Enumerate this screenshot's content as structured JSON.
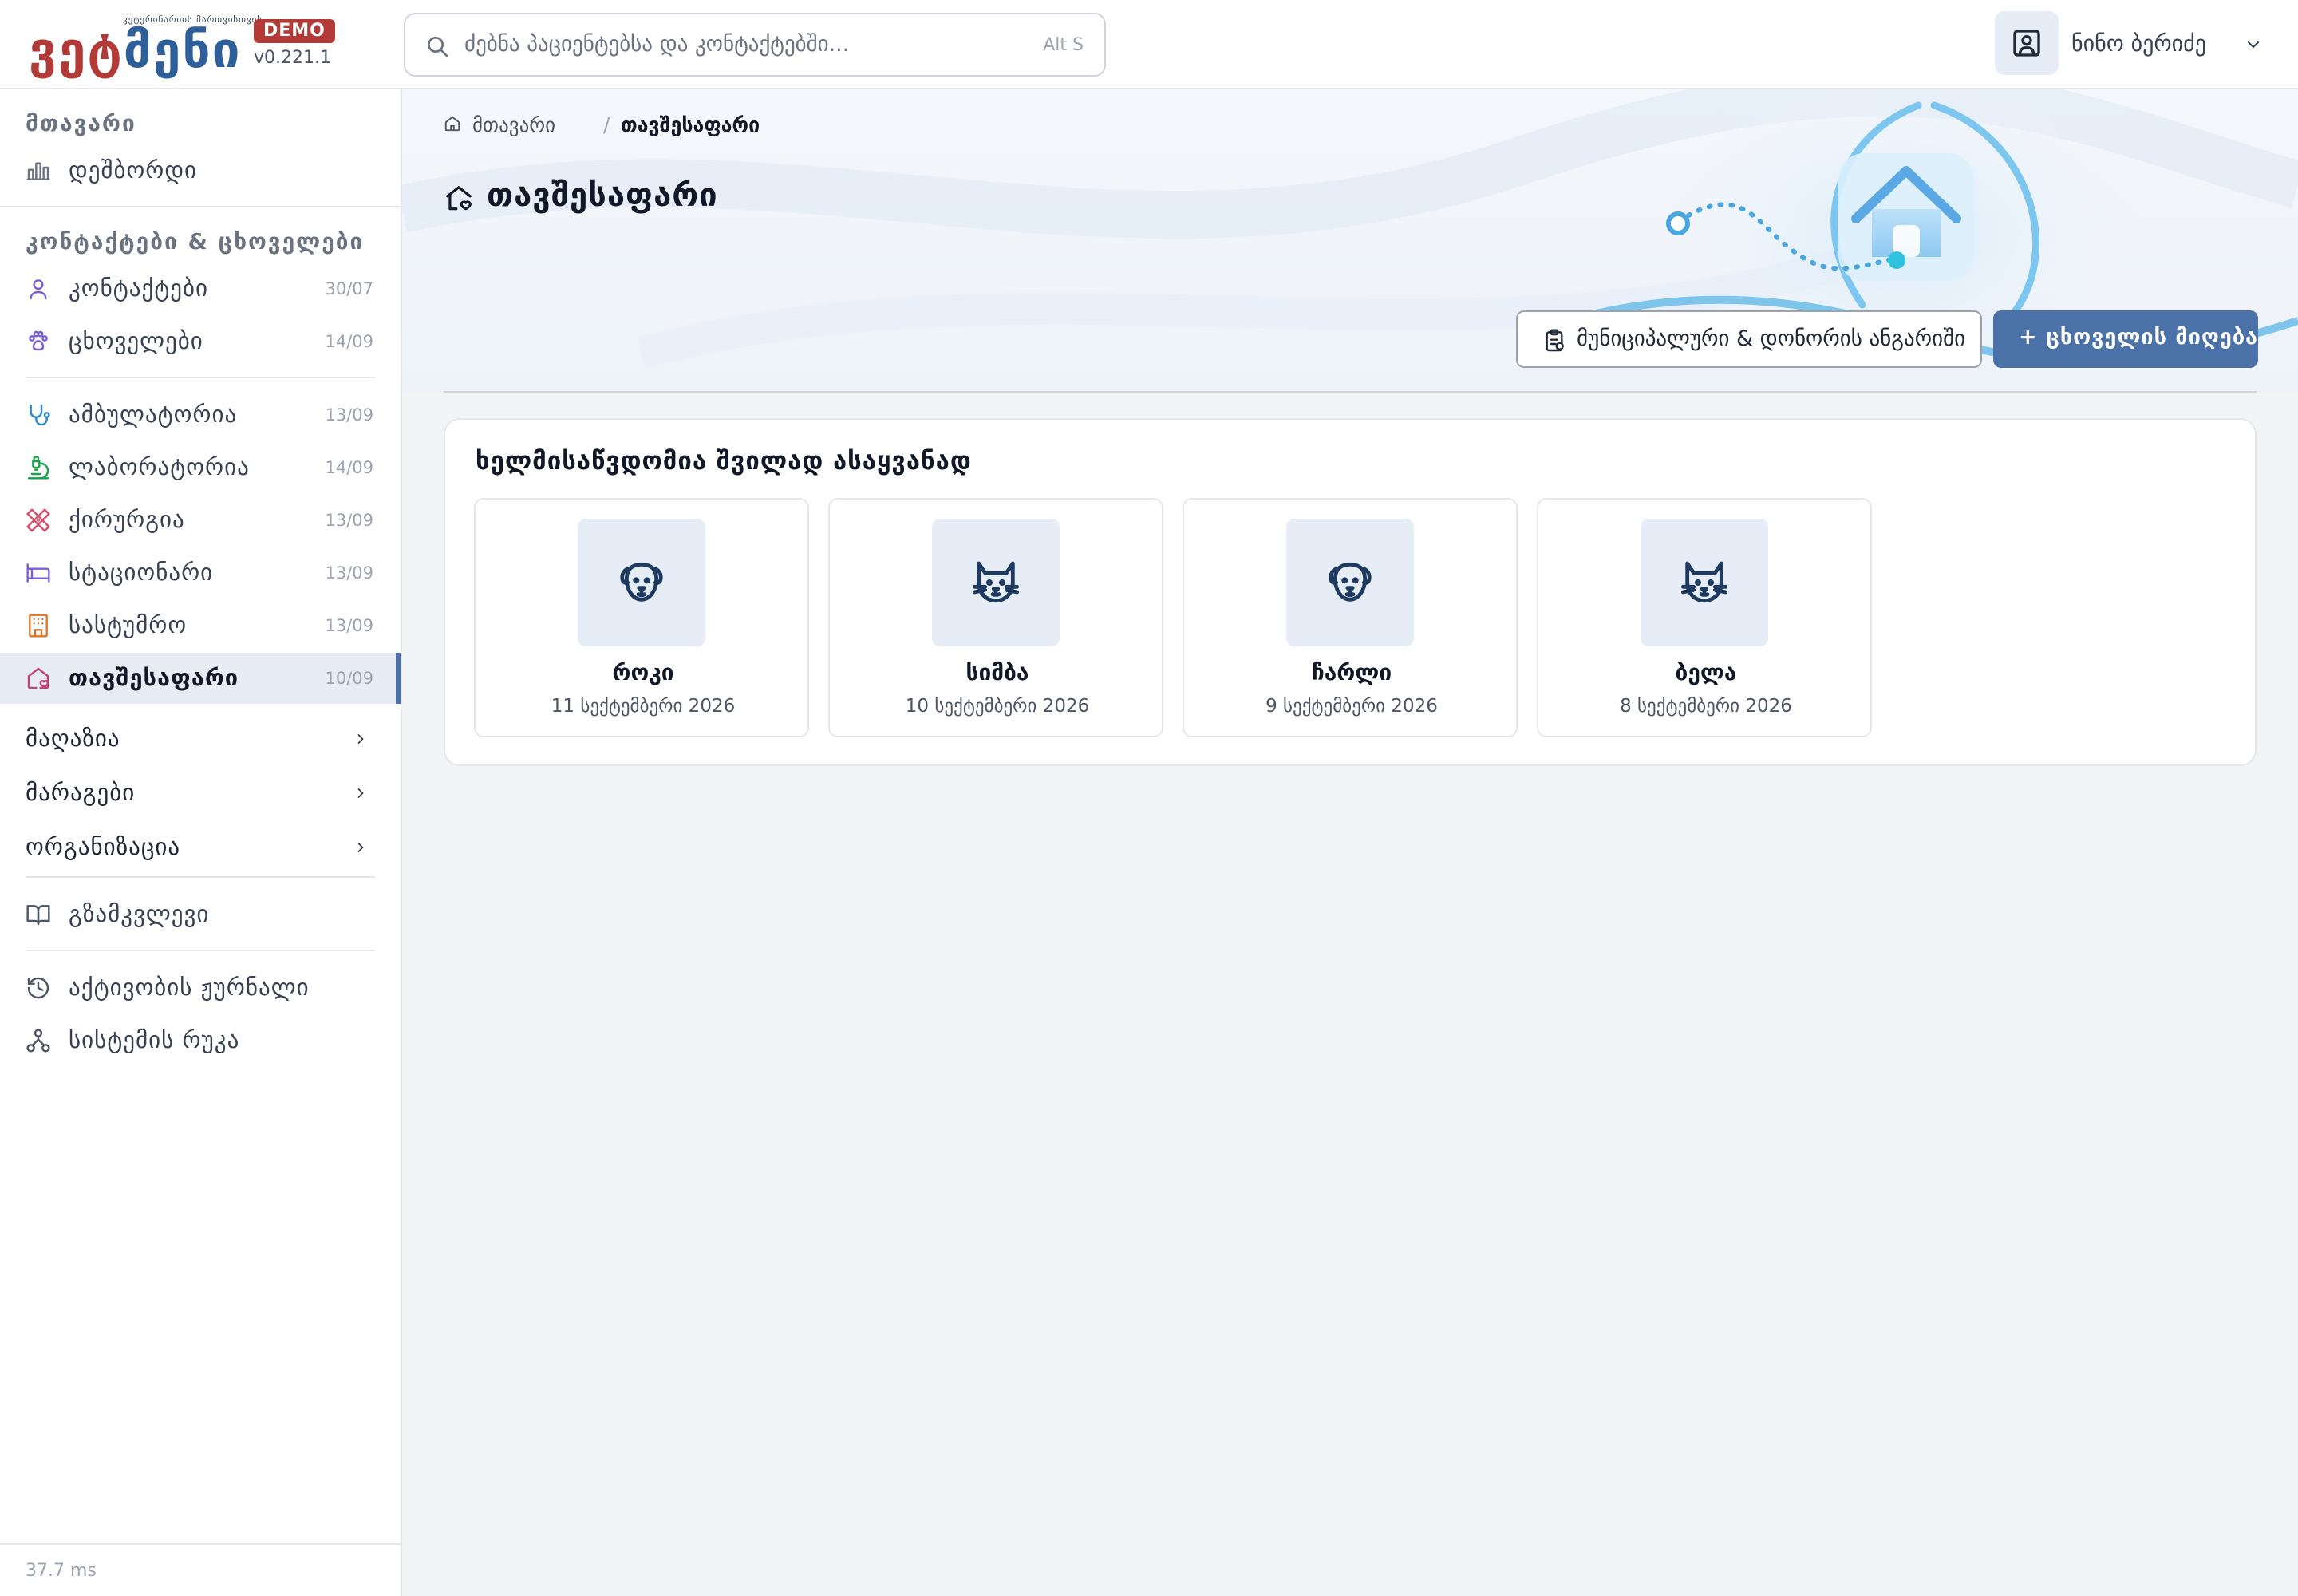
{
  "brand": {
    "logo_text_red": "ვეტ",
    "logo_text_blue": "მენი",
    "tagline": "ვეტერინარიის მართვისთვის",
    "badge": "DEMO",
    "version": "v0.221.1"
  },
  "search": {
    "placeholder": "ძებნა პაციენტებსა და კონტაქტებში...",
    "shortcut": "Alt S",
    "icon": "search-icon"
  },
  "user": {
    "name": "ნინო ბერიძე",
    "icon": "user-square-icon"
  },
  "sidebar": {
    "sections": [
      {
        "title": "მთავარი"
      },
      {
        "title": "კონტაქტები & ცხოველები"
      }
    ],
    "items": [
      {
        "label": "დეშბორდი",
        "count": "",
        "icon": "chart-bar-icon",
        "color": "#6b7280"
      },
      {
        "label": "კონტაქტები",
        "count": "30/07",
        "icon": "person-icon",
        "color": "#7c5cd6"
      },
      {
        "label": "ცხოველები",
        "count": "14/09",
        "icon": "paw-icon",
        "color": "#7c5cd6"
      },
      {
        "label": "ამბულატორია",
        "count": "13/09",
        "icon": "stethoscope-icon",
        "color": "#2a86c8"
      },
      {
        "label": "ლაბორატორია",
        "count": "14/09",
        "icon": "microscope-icon",
        "color": "#16a34a"
      },
      {
        "label": "ქირურგია",
        "count": "13/09",
        "icon": "bandage-icon",
        "color": "#dc4a6a"
      },
      {
        "label": "სტაციონარი",
        "count": "13/09",
        "icon": "bed-icon",
        "color": "#7c5cd6"
      },
      {
        "label": "სასტუმრო",
        "count": "13/09",
        "icon": "building-icon",
        "color": "#d9772b"
      },
      {
        "label": "თავშესაფარი",
        "count": "10/09",
        "icon": "home-heart-icon",
        "color": "#c0407a"
      }
    ],
    "groups": [
      {
        "label": "მაღაზია"
      },
      {
        "label": "მარაგები"
      },
      {
        "label": "ორგანიზაცია"
      }
    ],
    "bottom": [
      {
        "label": "გზამკვლევი",
        "icon": "book-icon"
      },
      {
        "label": "აქტივობის ჟურნალი",
        "icon": "history-icon"
      },
      {
        "label": "სისტემის რუკა",
        "icon": "sitemap-icon"
      }
    ],
    "footer": "37.7 ms"
  },
  "breadcrumb": {
    "items": [
      "მთავარი",
      "თავშესაფარი"
    ],
    "separator": "/"
  },
  "page": {
    "title": "თავშესაფარი"
  },
  "actions": {
    "report": "მუნიციპალური & დონორის ანგარიში",
    "intake": "+ ცხოველის მიღება"
  },
  "adoption": {
    "title": "ხელმისაწვდომია შვილად ასაყვანად",
    "animals": [
      {
        "name": "როკი",
        "date": "11 სექტემბერი 2026",
        "species": "dog-icon"
      },
      {
        "name": "სიმბა",
        "date": "10 სექტემბერი 2026",
        "species": "cat-icon"
      },
      {
        "name": "ჩარლი",
        "date": "9 სექტემბერი 2026",
        "species": "dog-icon"
      },
      {
        "name": "ბელა",
        "date": "8 სექტემბერი 2026",
        "species": "cat-icon"
      }
    ]
  },
  "colors": {
    "accent": "#4a72a8",
    "brand_red": "#b23a37",
    "brand_blue": "#2f5f98",
    "active_bg": "#e8edf5"
  }
}
